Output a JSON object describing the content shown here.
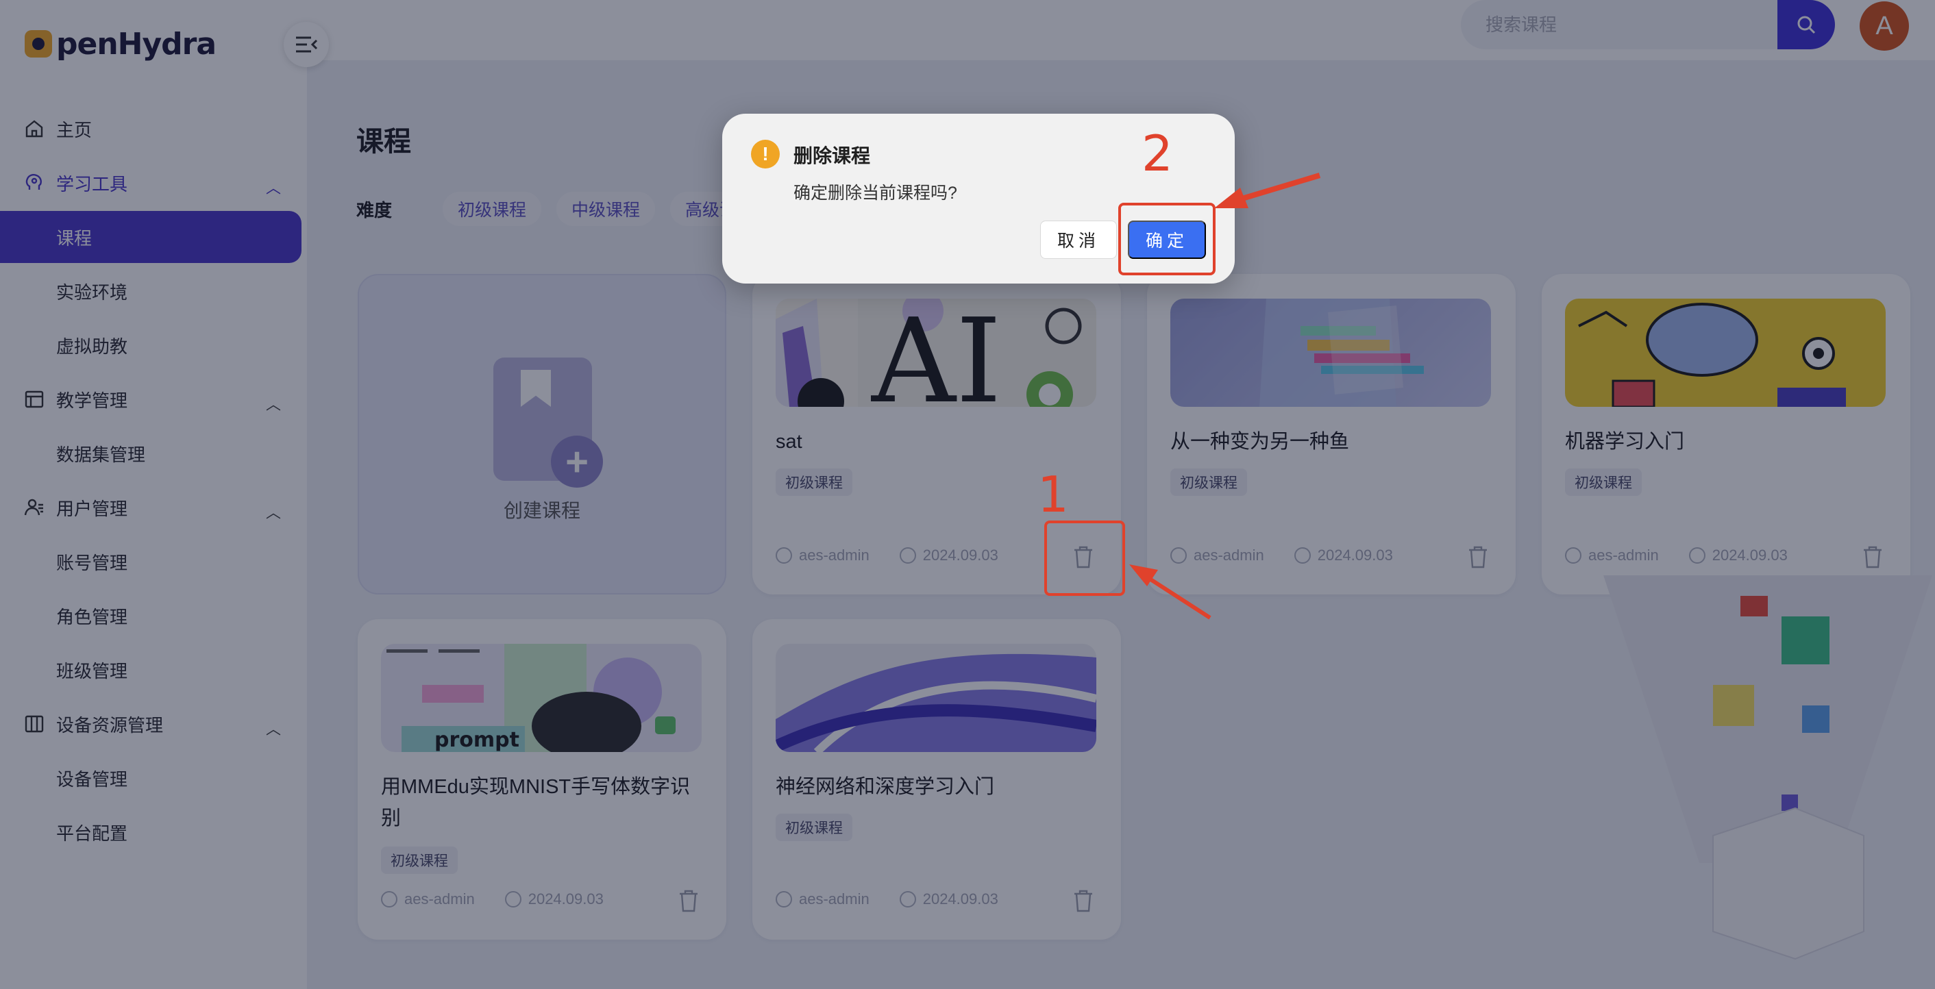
{
  "app": {
    "logo_text": "penHydra"
  },
  "sidebar": {
    "items": [
      {
        "label": "主页",
        "type": "item",
        "icon": "home-icon"
      },
      {
        "label": "学习工具",
        "type": "group",
        "icon": "brain-icon",
        "open": true,
        "active_group": true
      },
      {
        "label": "课程",
        "type": "sub",
        "active": true
      },
      {
        "label": "实验环境",
        "type": "sub"
      },
      {
        "label": "虚拟助教",
        "type": "sub"
      },
      {
        "label": "教学管理",
        "type": "group",
        "icon": "grid-icon",
        "open": true
      },
      {
        "label": "数据集管理",
        "type": "sub"
      },
      {
        "label": "用户管理",
        "type": "group",
        "icon": "users-icon",
        "open": true
      },
      {
        "label": "账号管理",
        "type": "sub"
      },
      {
        "label": "角色管理",
        "type": "sub"
      },
      {
        "label": "班级管理",
        "type": "sub"
      },
      {
        "label": "设备资源管理",
        "type": "group",
        "icon": "columns-icon",
        "open": true
      },
      {
        "label": "设备管理",
        "type": "sub"
      },
      {
        "label": "平台配置",
        "type": "sub"
      }
    ]
  },
  "header": {
    "search_placeholder": "搜索课程",
    "avatar_letter": "A"
  },
  "main": {
    "title": "课程",
    "filter_label": "难度",
    "chips": [
      "初级课程",
      "中级课程",
      "高级课程"
    ],
    "create_label": "创建课程",
    "cards": [
      {
        "title": "sat",
        "badge": "初级课程",
        "author": "aes-admin",
        "date": "2024.09.03",
        "thumb": "ai"
      },
      {
        "title": "从一种变为另一种鱼",
        "badge": "初级课程",
        "author": "aes-admin",
        "date": "2024.09.03",
        "thumb": "glass"
      },
      {
        "title": "机器学习入门",
        "badge": "初级课程",
        "author": "aes-admin",
        "date": "2024.09.03",
        "thumb": "brain"
      },
      {
        "title": "用MMEdu实现MNIST手写体数字识别",
        "badge": "初级课程",
        "author": "aes-admin",
        "date": "2024.09.03",
        "thumb": "prompt"
      },
      {
        "title": "神经网络和深度学习入门",
        "badge": "初级课程",
        "author": "aes-admin",
        "date": "2024.09.03",
        "thumb": "wave"
      }
    ],
    "thumb_text": {
      "ai": "AI",
      "prompt": "prompt"
    }
  },
  "modal": {
    "title": "删除课程",
    "message": "确定删除当前课程吗?",
    "cancel_label": "取消",
    "ok_label": "确定"
  },
  "annotations": {
    "step1": "1",
    "step2": "2",
    "color": "#e0422c"
  },
  "colors": {
    "accent": "#4a37c8",
    "primary_button": "#3a6ff2",
    "warning": "#f0a524"
  }
}
